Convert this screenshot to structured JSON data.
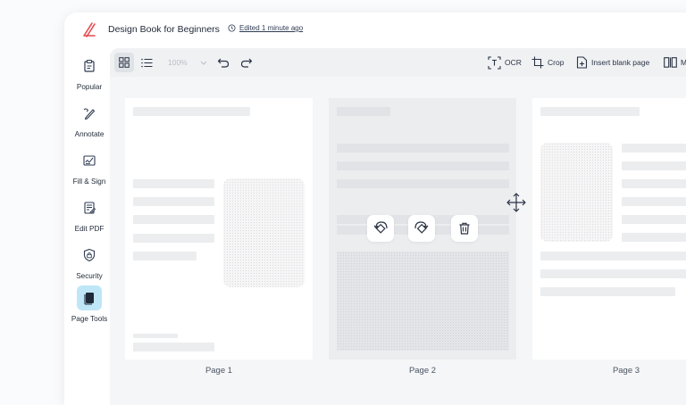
{
  "titlebar": {
    "doc_title": "Design Book for Beginners",
    "edited": "Edited 1 minute ago"
  },
  "sidebar": {
    "items": [
      {
        "label": "Popular",
        "icon": "clipboard-icon"
      },
      {
        "label": "Annotate",
        "icon": "annotate-pen-icon"
      },
      {
        "label": "Fill & Sign",
        "icon": "signature-icon"
      },
      {
        "label": "Edit PDF",
        "icon": "edit-document-icon"
      },
      {
        "label": "Security",
        "icon": "shield-lock-icon"
      },
      {
        "label": "Page Tools",
        "icon": "pages-icon",
        "active": true
      }
    ]
  },
  "toolbar": {
    "zoom": "100%",
    "ocr": "OCR",
    "crop": "Crop",
    "insert_blank": "Insert blank page",
    "more": "M"
  },
  "pages": [
    {
      "label": "Page 1"
    },
    {
      "label": "Page 2"
    },
    {
      "label": "Page 3"
    }
  ],
  "colors": {
    "brand": "#e5484d",
    "active_tool_bg": "#bfe6f7",
    "icon_dark": "#2f3b52"
  }
}
